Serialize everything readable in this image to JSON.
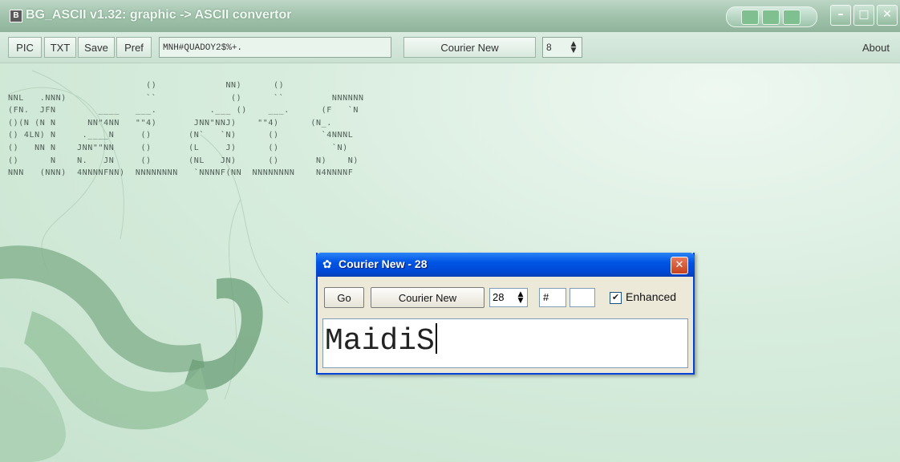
{
  "window": {
    "title": "BG_ASCII v1.32: graphic -> ASCII convertor",
    "title_icon": "app-icon",
    "controls": [
      "minimize",
      "maximize",
      "close"
    ]
  },
  "toolbar": {
    "buttons": [
      "PIC",
      "TXT",
      "Save",
      "Pref"
    ],
    "chars_value": "MNH#QUADOY2$%+.",
    "font_button": "Courier New",
    "size_value": "8",
    "about_label": "About"
  },
  "ascii_art": "                          ()             NN)      ()\nNNL   .NNN)               ``              ()      ``         NNNNNN\n(FN.  JFN        ____   ___.          .___ ()    ___.      (F   `N\n()(N (N N      NN\"4NN   \"\"4)       JNN\"NNJ)    \"\"4)      (N_.\n() 4LN) N     .____N     ()       (N`   `N)      ()        `4NNNL\n()   NN N    JNN\"\"NN     ()       (L     J)      ()          `N)\n()      N    N.   JN     ()       (NL   JN)      ()       N)    N)\nNNN   (NNN)  4NNNNFNN)  NNNNNNNN   `NNNNF(NN  NNNNNNNN    N4NNNNF",
  "dialog": {
    "title": "Courier New - 28",
    "go_label": "Go",
    "font_button": "Courier New",
    "size_value": "28",
    "char_value": "#",
    "extra_value": "",
    "enhanced_label": "Enhanced",
    "enhanced_checked": true,
    "preview_text": "MaidiS"
  }
}
